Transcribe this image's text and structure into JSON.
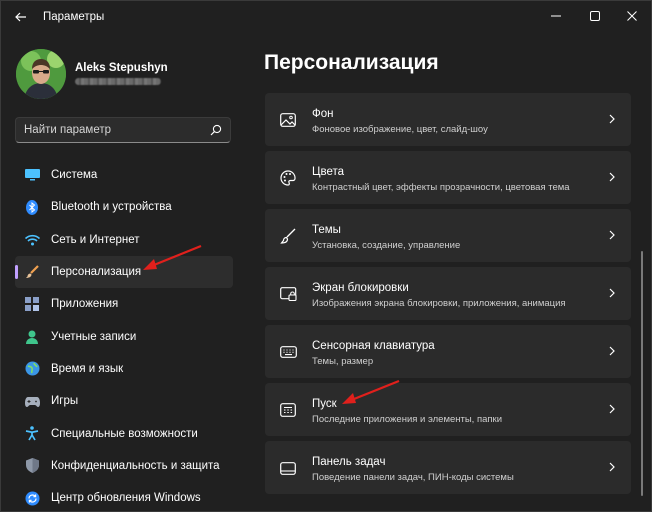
{
  "app": {
    "title": "Параметры"
  },
  "profile": {
    "name": "Aleks Stepushyn"
  },
  "search": {
    "placeholder": "Найти параметр"
  },
  "nav": {
    "items": [
      {
        "label": "Система",
        "icon": "system-icon",
        "active": false
      },
      {
        "label": "Bluetooth и устройства",
        "icon": "bluetooth-icon",
        "active": false
      },
      {
        "label": "Сеть и Интернет",
        "icon": "wifi-icon",
        "active": false
      },
      {
        "label": "Персонализация",
        "icon": "brush-icon",
        "active": true
      },
      {
        "label": "Приложения",
        "icon": "apps-icon",
        "active": false
      },
      {
        "label": "Учетные записи",
        "icon": "accounts-icon",
        "active": false
      },
      {
        "label": "Время и язык",
        "icon": "time-language-icon",
        "active": false
      },
      {
        "label": "Игры",
        "icon": "gamepad-icon",
        "active": false
      },
      {
        "label": "Специальные возможности",
        "icon": "accessibility-icon",
        "active": false
      },
      {
        "label": "Конфиденциальность и защита",
        "icon": "shield-icon",
        "active": false
      },
      {
        "label": "Центр обновления Windows",
        "icon": "update-icon",
        "active": false
      }
    ]
  },
  "main": {
    "title": "Персонализация",
    "cards": [
      {
        "title": "Фон",
        "subtitle": "Фоновое изображение, цвет, слайд-шоу",
        "icon": "image-icon"
      },
      {
        "title": "Цвета",
        "subtitle": "Контрастный цвет, эффекты прозрачности, цветовая тема",
        "icon": "palette-icon"
      },
      {
        "title": "Темы",
        "subtitle": "Установка, создание, управление",
        "icon": "brush-icon"
      },
      {
        "title": "Экран блокировки",
        "subtitle": "Изображения экрана блокировки, приложения, анимация",
        "icon": "lock-screen-icon"
      },
      {
        "title": "Сенсорная клавиатура",
        "subtitle": "Темы, размер",
        "icon": "keyboard-icon"
      },
      {
        "title": "Пуск",
        "subtitle": "Последние приложения и элементы, папки",
        "icon": "start-icon"
      },
      {
        "title": "Панель задач",
        "subtitle": "Поведение панели задач, ПИН-коды системы",
        "icon": "taskbar-icon"
      }
    ]
  },
  "colors": {
    "background": "#202020",
    "card": "#2b2b2b",
    "accent": "#c1a0ff",
    "annotation_arrow": "#e0201c"
  }
}
